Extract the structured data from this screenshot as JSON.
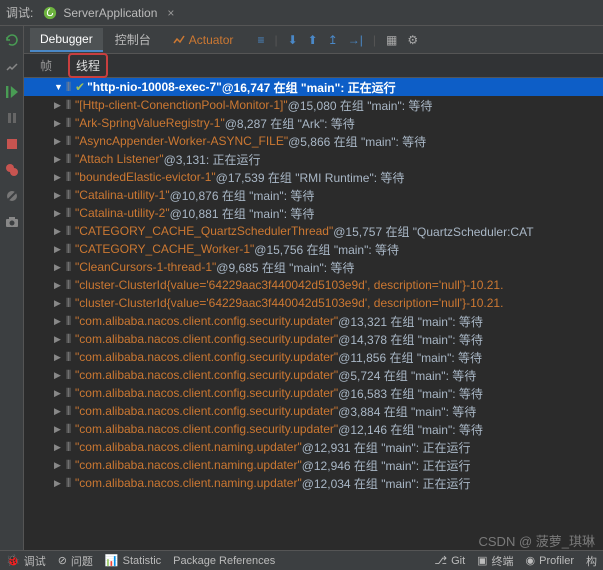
{
  "top": {
    "debug_label": "调试:",
    "app_name": "ServerApplication",
    "close": "×"
  },
  "tabs": {
    "debugger": "Debugger",
    "console": "控制台",
    "actuator": "Actuator"
  },
  "toolbar_icons": [
    "≡",
    "⬇",
    "⬆",
    "↥",
    "→|",
    "▦",
    "⚙"
  ],
  "sub_tabs": {
    "frame": "帧",
    "threads": "线程"
  },
  "threads": [
    {
      "selected": true,
      "check": true,
      "name": "\"http-nio-10008-exec-7\"",
      "rest": "@16,747 在组 \"main\": 正在运行"
    },
    {
      "name": "\"[Http-client-ConenctionPool-Monitor-1]\"",
      "rest": "@15,080 在组 \"main\": 等待"
    },
    {
      "name": "\"Ark-SpringValueRegistry-1\"",
      "rest": "@8,287 在组 \"Ark\": 等待"
    },
    {
      "name": "\"AsyncAppender-Worker-ASYNC_FILE\"",
      "rest": "@5,866 在组 \"main\": 等待"
    },
    {
      "name": "\"Attach Listener\"",
      "rest": "@3,131: 正在运行"
    },
    {
      "name": "\"boundedElastic-evictor-1\"",
      "rest": "@17,539 在组 \"RMI Runtime\": 等待"
    },
    {
      "name": "\"Catalina-utility-1\"",
      "rest": "@10,876 在组 \"main\": 等待"
    },
    {
      "name": "\"Catalina-utility-2\"",
      "rest": "@10,881 在组 \"main\": 等待"
    },
    {
      "name": "\"CATEGORY_CACHE_QuartzSchedulerThread\"",
      "rest": "@15,757 在组 \"QuartzScheduler:CAT"
    },
    {
      "name": "\"CATEGORY_CACHE_Worker-1\"",
      "rest": "@15,756 在组 \"main\": 等待"
    },
    {
      "name": "\"CleanCursors-1-thread-1\"",
      "rest": "@9,685 在组 \"main\": 等待"
    },
    {
      "name": "\"cluster-ClusterId{value='64229aac3f440042d5103e9d', description='null'}-10.21."
    },
    {
      "name": "\"cluster-ClusterId{value='64229aac3f440042d5103e9d', description='null'}-10.21."
    },
    {
      "name": "\"com.alibaba.nacos.client.config.security.updater\"",
      "rest": "@13,321 在组 \"main\": 等待"
    },
    {
      "name": "\"com.alibaba.nacos.client.config.security.updater\"",
      "rest": "@14,378 在组 \"main\": 等待"
    },
    {
      "name": "\"com.alibaba.nacos.client.config.security.updater\"",
      "rest": "@11,856 在组 \"main\": 等待"
    },
    {
      "name": "\"com.alibaba.nacos.client.config.security.updater\"",
      "rest": "@5,724 在组 \"main\": 等待"
    },
    {
      "name": "\"com.alibaba.nacos.client.config.security.updater\"",
      "rest": "@16,583 在组 \"main\": 等待"
    },
    {
      "name": "\"com.alibaba.nacos.client.config.security.updater\"",
      "rest": "@3,884 在组 \"main\": 等待"
    },
    {
      "name": "\"com.alibaba.nacos.client.config.security.updater\"",
      "rest": "@12,146 在组 \"main\": 等待"
    },
    {
      "name": "\"com.alibaba.nacos.client.naming.updater\"",
      "rest": "@12,931 在组 \"main\": 正在运行"
    },
    {
      "name": "\"com.alibaba.nacos.client.naming.updater\"",
      "rest": "@12,946 在组 \"main\": 正在运行"
    },
    {
      "name": "\"com.alibaba.nacos.client.naming.updater\"",
      "rest": "@12,034 在组 \"main\": 正在运行"
    }
  ],
  "bottom": {
    "debug": "调试",
    "problems": "问题",
    "statistic": "Statistic",
    "package_refs": "Package References",
    "git": "Git",
    "terminal": "终端",
    "profiler": "Profiler",
    "build": "构"
  },
  "watermark": "CSDN @ 菠萝_琪琳"
}
